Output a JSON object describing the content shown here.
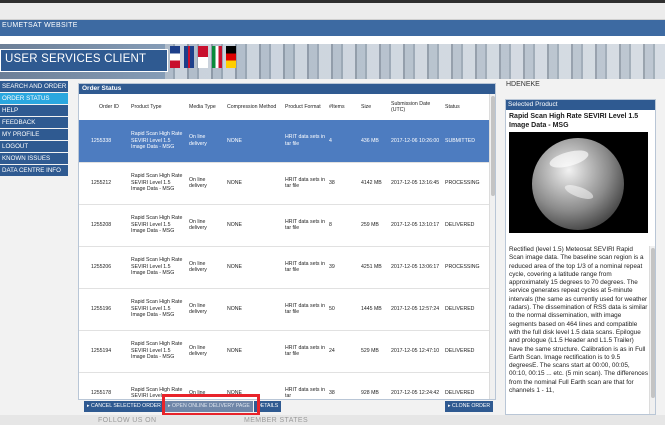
{
  "site": {
    "name": "EUMETSAT WEBSITE"
  },
  "app": {
    "title": "USER SERVICES CLIENT"
  },
  "nav": {
    "items": [
      {
        "label": "SEARCH AND ORDER"
      },
      {
        "label": "ORDER STATUS",
        "active": true
      },
      {
        "label": "HELP"
      },
      {
        "label": "FEEDBACK"
      },
      {
        "label": "MY PROFILE"
      },
      {
        "label": "LOGOUT"
      },
      {
        "label": "KNOWN ISSUES"
      },
      {
        "label": "DATA CENTRE INFO"
      }
    ]
  },
  "order_status": {
    "title": "Order Status",
    "columns": [
      "Order ID",
      "Product Type",
      "Media Type",
      "Compression Method",
      "Product Format",
      "#Items",
      "Size",
      "Submission Date (UTC)",
      "Status"
    ],
    "rows": [
      {
        "id": "1255338",
        "product": "Rapid Scan High Rate SEVIRI Level 1.5 Image Data - MSG",
        "media": "On line delivery",
        "compression": "NONE",
        "format": "HRIT data sets in tar file",
        "items": "4",
        "size": "436 MB",
        "date": "2017-12-06 10:26:00",
        "status": "SUBMITTED",
        "selected": true
      },
      {
        "id": "1255212",
        "product": "Rapid Scan High Rate SEVIRI Level 1.5 Image Data - MSG",
        "media": "On line delivery",
        "compression": "NONE",
        "format": "HRIT data sets in tar file",
        "items": "38",
        "size": "4142 MB",
        "date": "2017-12-05 13:16:45",
        "status": "PROCESSING"
      },
      {
        "id": "1255208",
        "product": "Rapid Scan High Rate SEVIRI Level 1.5 Image Data - MSG",
        "media": "On line delivery",
        "compression": "NONE",
        "format": "HRIT data sets in tar file",
        "items": "8",
        "size": "259 MB",
        "date": "2017-12-05 13:10:17",
        "status": "DELIVERED"
      },
      {
        "id": "1255206",
        "product": "Rapid Scan High Rate SEVIRI Level 1.5 Image Data - MSG",
        "media": "On line delivery",
        "compression": "NONE",
        "format": "HRIT data sets in tar file",
        "items": "39",
        "size": "4251 MB",
        "date": "2017-12-05 13:06:17",
        "status": "PROCESSING"
      },
      {
        "id": "1255196",
        "product": "Rapid Scan High Rate SEVIRI Level 1.5 Image Data - MSG",
        "media": "On line delivery",
        "compression": "NONE",
        "format": "HRIT data sets in tar file",
        "items": "50",
        "size": "1445 MB",
        "date": "2017-12-05 12:57:24",
        "status": "DELIVERED"
      },
      {
        "id": "1255194",
        "product": "Rapid Scan High Rate SEVIRI Level 1.5 Image Data - MSG",
        "media": "On line delivery",
        "compression": "NONE",
        "format": "HRIT data sets in tar file",
        "items": "24",
        "size": "529 MB",
        "date": "2017-12-05 12:47:10",
        "status": "DELIVERED"
      },
      {
        "id": "1255178",
        "product": "Rapid Scan High Rate SEVIRI Level",
        "media": "On line",
        "compression": "NONE",
        "format": "HRIT data sets in tar",
        "items": "38",
        "size": "928 MB",
        "date": "2017-12-05 12:24:42",
        "status": "DELIVERED"
      }
    ]
  },
  "actions": {
    "cancel": "CANCEL SELECTED ORDER",
    "open_delivery": "OPEN ONLINE DELIVERY PAGE",
    "details": "DETAILS",
    "clone": "CLONE ORDER"
  },
  "user": {
    "name": "HDENEKE"
  },
  "selected_product": {
    "title": "Selected Product",
    "name": "Rapid Scan High Rate SEVIRI Level 1.5 Image Data - MSG",
    "description": "Rectified (level 1.5) Meteosat SEVIRI Rapid Scan image data. The baseline scan region is a reduced area of the top 1/3 of a nominal repeat cycle, covering a latitude range from approximately 15 degrees to 70 degrees. The service generates repeat cycles at 5-minute intervals (the same as currently used for weather radars). The dissemination of RSS data is similar to the normal dissemination, with image segments based on 464 lines and compatible with the full disk level 1.5 data scans. Epilogue and prologue (L1.5 Header and L1.5 Trailer) have the same structure. Calibration is as in Full Earth Scan. Image rectification is to 9.5 degreesE. The scans start at 00:00, 00:05, 00:10, 00:15 ... etc. (5 min scan). The differences from the nominal Full Earth scan are that for channels 1 - 11,"
  },
  "footer": {
    "follow": "FOLLOW US ON",
    "members": "MEMBER STATES"
  },
  "colors": {
    "brand": "#2f5a91",
    "active_nav": "#2aa7df",
    "selected_row": "#4d7cc0",
    "highlight": "#e8232a"
  }
}
